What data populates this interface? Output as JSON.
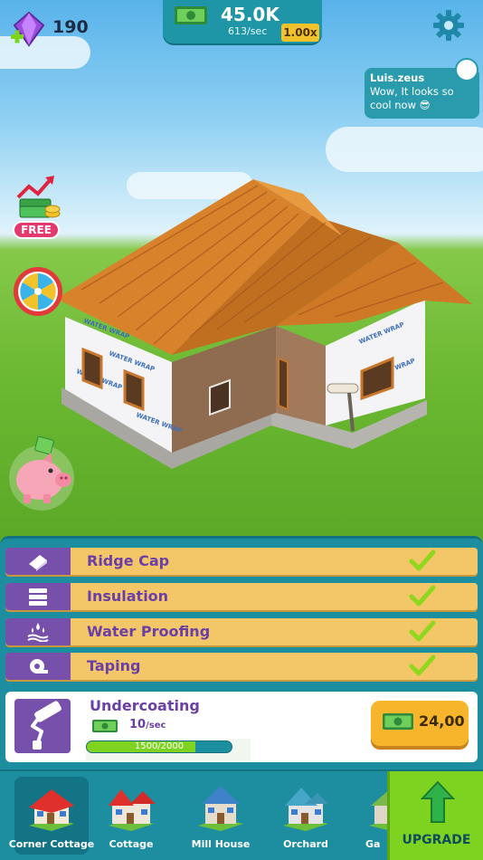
{
  "hud": {
    "gems": "190",
    "cash": "45.0K",
    "cash_rate": "613/sec",
    "multiplier": "1.00x"
  },
  "chat": {
    "user": "Luis.zeus",
    "message": "Wow, It looks so cool now 😎"
  },
  "bonus": {
    "free_label": "FREE"
  },
  "tasks": [
    {
      "label": "Ridge Cap",
      "icon": "ridge-cap-icon",
      "done": true
    },
    {
      "label": "Insulation",
      "icon": "insulation-icon",
      "done": true
    },
    {
      "label": "Water Proofing",
      "icon": "water-drops-icon",
      "done": true
    },
    {
      "label": "Taping",
      "icon": "tape-roll-icon",
      "done": true
    }
  ],
  "current_task": {
    "title": "Undercoating",
    "rate": "10",
    "rate_unit": "/sec",
    "progress_text": "1500/2000",
    "progress": 0.75,
    "price": "24,00"
  },
  "houses": [
    {
      "label": "Corner Cottage",
      "active": true
    },
    {
      "label": "Cottage",
      "active": false
    },
    {
      "label": "Mill House",
      "active": false
    },
    {
      "label": "Orchard",
      "active": false
    },
    {
      "label": "Ga",
      "active": false
    }
  ],
  "upgrade_label": "UPGRADE",
  "colors": {
    "accent_teal": "#1d8ea0",
    "task_bg": "#f3c667",
    "task_icon_bg": "#7750ab",
    "check_green": "#8fd81e",
    "buy_button": "#f7b52b",
    "upgrade_green": "#7ed321"
  }
}
